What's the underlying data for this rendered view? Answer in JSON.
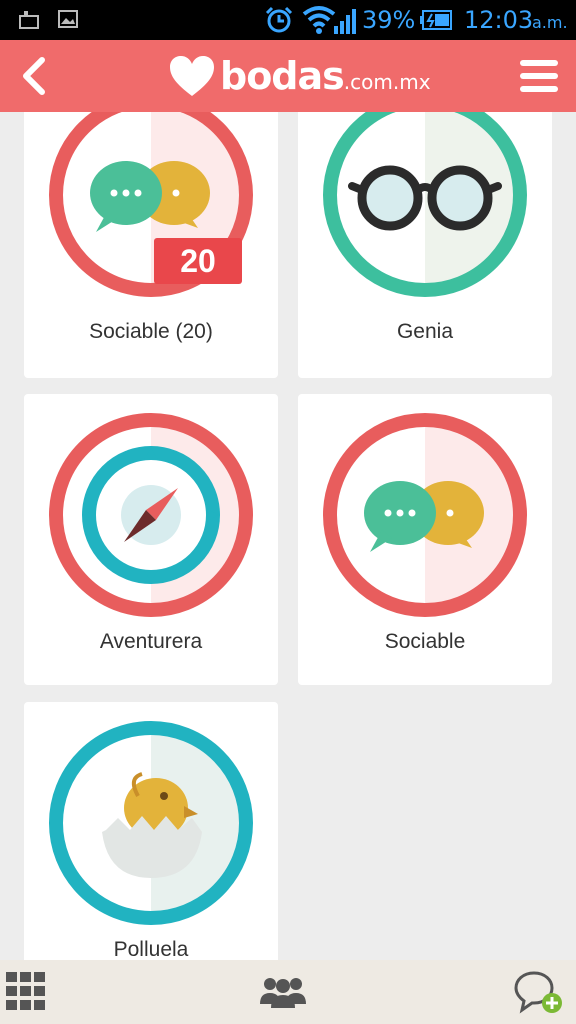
{
  "status_bar": {
    "battery_percent": "39%",
    "time": "12:03",
    "ampm": "a.m.",
    "icons": [
      "screenshot-icon",
      "image-icon",
      "alarm-icon",
      "wifi-icon",
      "signal-icon",
      "battery-icon"
    ]
  },
  "app_bar": {
    "logo_text": "bodas",
    "logo_domain": ".com.mx",
    "icons": [
      "back-arrow-icon",
      "heart-logo-icon",
      "hamburger-menu-icon"
    ],
    "color": "#f06b6b"
  },
  "badges": [
    {
      "label": "Sociable (20)",
      "icon": "chat-bubbles-icon",
      "count": "20",
      "ring": "#e85d5d"
    },
    {
      "label": "Genia",
      "icon": "glasses-icon",
      "ring": "#3dbf9e"
    },
    {
      "label": "Aventurera",
      "icon": "compass-icon",
      "ring": "#e85d5d"
    },
    {
      "label": "Sociable",
      "icon": "chat-bubbles-icon",
      "ring": "#e85d5d"
    },
    {
      "label": "Polluela",
      "icon": "chick-icon",
      "ring": "#21b3c1"
    }
  ],
  "bottom_nav": {
    "items": [
      "grid-icon",
      "users-icon",
      "add-comment-icon"
    ]
  }
}
